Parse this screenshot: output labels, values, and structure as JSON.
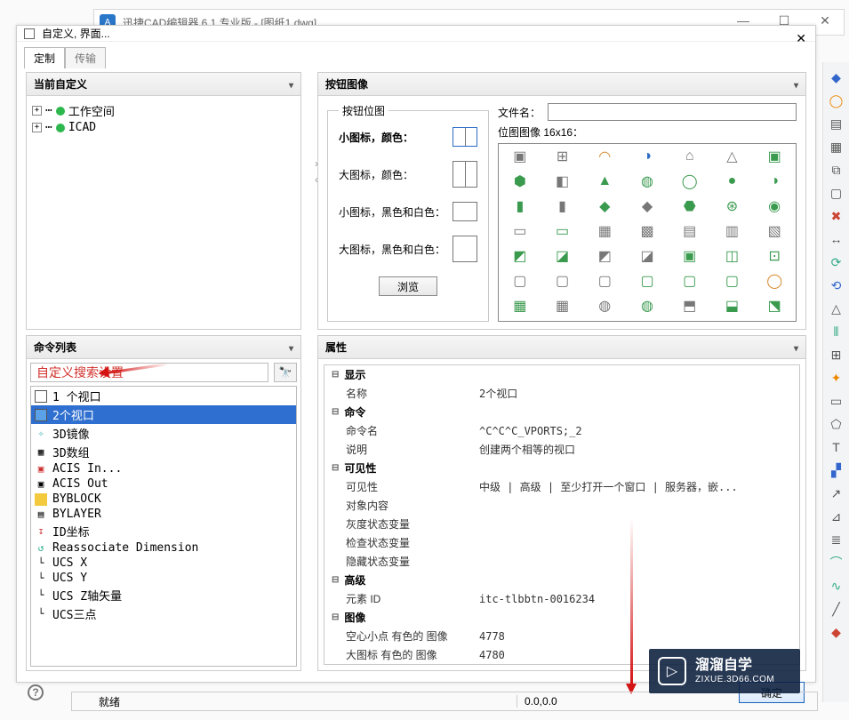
{
  "back_window": {
    "title": "迅捷CAD编辑器 6.1 专业版  - [图纸1.dwg]"
  },
  "dialog": {
    "title": "自定义, 界面...",
    "tabs": {
      "customize": "定制",
      "transfer": "传输"
    }
  },
  "current_custom": {
    "header": "当前自定义",
    "items": [
      {
        "label": "工作空间"
      },
      {
        "label": "ICAD"
      }
    ]
  },
  "command_list": {
    "header": "命令列表",
    "search_placeholder": "自定义搜索设置",
    "items": [
      {
        "label": "1 个视口",
        "selected": false
      },
      {
        "label": "2个视口",
        "selected": true
      },
      {
        "label": "3D镜像",
        "selected": false
      },
      {
        "label": "3D数组",
        "selected": false
      },
      {
        "label": "ACIS In...",
        "selected": false
      },
      {
        "label": "ACIS Out",
        "selected": false
      },
      {
        "label": "BYBLOCK",
        "selected": false
      },
      {
        "label": "BYLAYER",
        "selected": false
      },
      {
        "label": "ID坐标",
        "selected": false
      },
      {
        "label": "Reassociate Dimension",
        "selected": false
      },
      {
        "label": "UCS X",
        "selected": false
      },
      {
        "label": "UCS Y",
        "selected": false
      },
      {
        "label": "UCS Z轴矢量",
        "selected": false
      },
      {
        "label": "UCS三点",
        "selected": false
      }
    ]
  },
  "button_image": {
    "header": "按钮图像",
    "bitmap_legend": "按钮位图",
    "rows": {
      "small_color": "小图标，颜色：",
      "large_color": "大图标，颜色：",
      "small_bw": "小图标，黑色和白色：",
      "large_bw": "大图标，黑色和白色："
    },
    "browse": "浏览",
    "file_label": "文件名：",
    "grid_label": "位图图像 16x16："
  },
  "properties": {
    "header": "属性",
    "groups": {
      "display": "显示",
      "command": "命令",
      "visibility": "可见性",
      "advanced": "高级",
      "image": "图像"
    },
    "rows": {
      "name_k": "名称",
      "name_v": "2个视口",
      "cmdname_k": "命令名",
      "cmdname_v": "^C^C^C_VPORTS;_2",
      "desc_k": "说明",
      "desc_v": "创建两个相等的视口",
      "vis_k": "可见性",
      "vis_v": "中级 | 高级 | 至少打开一个窗口 | 服务器，嵌...",
      "objcontent_k": "对象内容",
      "objcontent_v": "",
      "grayvar_k": "灰度状态变量",
      "grayvar_v": "",
      "checkvar_k": "检查状态变量",
      "checkvar_v": "",
      "hidevar_k": "隐藏状态变量",
      "hidevar_v": "",
      "elemid_k": "元素 ID",
      "elemid_v": "itc-tlbbtn-0016234",
      "hollow_k": "空心小点 有色的 图像",
      "hollow_v": "4778",
      "largeimg_k": "大图标 有色的 图像",
      "largeimg_v": "4780"
    }
  },
  "footer": {
    "ok": "确定"
  },
  "status": {
    "ready": "就绪",
    "coords": "0.0,0.0"
  },
  "watermark": {
    "brand": "溜溜自学",
    "domain": "ZIXUE.3D66.COM"
  }
}
